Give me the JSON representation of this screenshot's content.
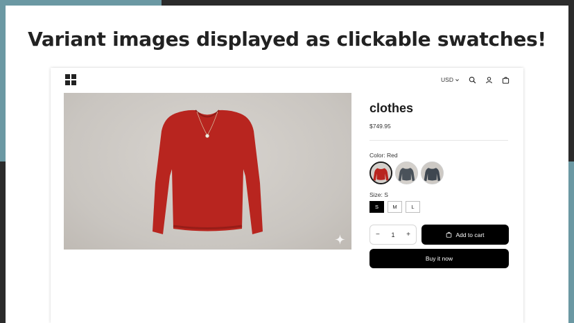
{
  "headline": "Variant images displayed as clickable swatches!",
  "colors": {
    "background_dark": "#2b2b2b",
    "background_teal": "#6b98a3",
    "sweater_red": "#b8251f",
    "sweater_gray": "#4a525a",
    "button_black": "#000000"
  },
  "header": {
    "logo_icon": "grid-logo-icon",
    "currency": "USD",
    "icons": [
      "search-icon",
      "account-icon",
      "cart-icon"
    ]
  },
  "product": {
    "title": "clothes",
    "price": "$749.95",
    "color_label": "Color: Red",
    "color_swatches": [
      {
        "name": "Red",
        "selected": true
      },
      {
        "name": "Gray",
        "selected": false
      },
      {
        "name": "Gray",
        "selected": false
      }
    ],
    "size_label": "Size: S",
    "sizes": [
      "S",
      "M",
      "L"
    ],
    "selected_size": "S",
    "quantity": "1",
    "qty_minus": "−",
    "qty_plus": "+",
    "add_to_cart": "Add to cart",
    "buy_now": "Buy it now"
  }
}
